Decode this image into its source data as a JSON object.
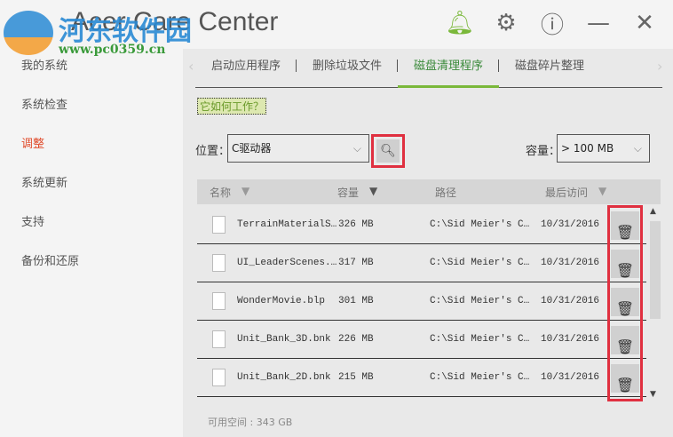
{
  "app": {
    "title": "Acer Care Center",
    "watermark_line1": "河东软件园",
    "watermark_line2": "www.pc0359.cn"
  },
  "sidebar": {
    "items": [
      {
        "label": "我的系统"
      },
      {
        "label": "系统检查"
      },
      {
        "label": "调整"
      },
      {
        "label": "系统更新"
      },
      {
        "label": "支持"
      },
      {
        "label": "备份和还原"
      }
    ]
  },
  "tabs": [
    {
      "label": "启动应用程序"
    },
    {
      "label": "删除垃圾文件"
    },
    {
      "label": "磁盘清理程序"
    },
    {
      "label": "磁盘碎片整理"
    }
  ],
  "how_link": "它如何工作？",
  "location": {
    "label": "位置：",
    "value": "C驱动器"
  },
  "capacity": {
    "label": "容量：",
    "value": "> 100 MB"
  },
  "table": {
    "headers": [
      "名称",
      "容量",
      "路径",
      "最后访问"
    ],
    "rows": [
      {
        "name": "TerrainMaterialS…",
        "size": "326 MB",
        "path": "C:\\Sid Meier's C…",
        "date": "10/31/2016"
      },
      {
        "name": "UI_LeaderScenes.…",
        "size": "317 MB",
        "path": "C:\\Sid Meier's C…",
        "date": "10/31/2016"
      },
      {
        "name": "WonderMovie.blp",
        "size": "301 MB",
        "path": "C:\\Sid Meier's C…",
        "date": "10/31/2016"
      },
      {
        "name": "Unit_Bank_3D.bnk",
        "size": "226 MB",
        "path": "C:\\Sid Meier's C…",
        "date": "10/31/2016"
      },
      {
        "name": "Unit_Bank_2D.bnk",
        "size": "215 MB",
        "path": "C:\\Sid Meier's C…",
        "date": "10/31/2016"
      }
    ]
  },
  "free_space": "可用空间 : 343 GB"
}
